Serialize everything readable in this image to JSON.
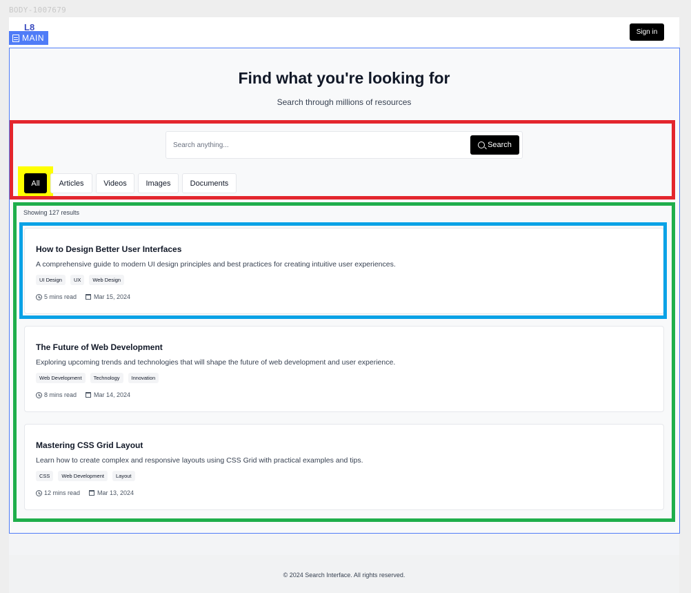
{
  "debug": {
    "body_label": "BODY-1007679",
    "main_label": "MAIN"
  },
  "header": {
    "logo_text": "L8",
    "signin_label": "Sign in"
  },
  "hero": {
    "title": "Find what you're looking for",
    "subtitle": "Search through millions of resources"
  },
  "search": {
    "placeholder": "Search anything...",
    "value": "",
    "button_label": "Search",
    "button_icon": "search-icon"
  },
  "filters": [
    {
      "label": "All",
      "active": true
    },
    {
      "label": "Articles",
      "active": false
    },
    {
      "label": "Videos",
      "active": false
    },
    {
      "label": "Images",
      "active": false
    },
    {
      "label": "Documents",
      "active": false
    }
  ],
  "results": {
    "count_text": "Showing 127 results",
    "items": [
      {
        "title": "How to Design Better User Interfaces",
        "description": "A comprehensive guide to modern UI design principles and best practices for creating intuitive user experiences.",
        "tags": [
          "UI Design",
          "UX",
          "Web Design"
        ],
        "read_time": "5 mins read",
        "date": "Mar 15, 2024"
      },
      {
        "title": "The Future of Web Development",
        "description": "Exploring upcoming trends and technologies that will shape the future of web development and user experience.",
        "tags": [
          "Web Development",
          "Technology",
          "Innovation"
        ],
        "read_time": "8 mins read",
        "date": "Mar 14, 2024"
      },
      {
        "title": "Mastering CSS Grid Layout",
        "description": "Learn how to create complex and responsive layouts using CSS Grid with practical examples and tips.",
        "tags": [
          "CSS",
          "Web Development",
          "Layout"
        ],
        "read_time": "12 mins read",
        "date": "Mar 13, 2024"
      }
    ]
  },
  "footer": {
    "text": "© 2024 Search Interface. All rights reserved."
  },
  "colors": {
    "accent": "#000000",
    "outline_main": "#4f7cf7",
    "outline_search": "#e3262d",
    "outline_results": "#1fae4b",
    "outline_card": "#0aa2e6",
    "highlight": "#ffff00"
  }
}
